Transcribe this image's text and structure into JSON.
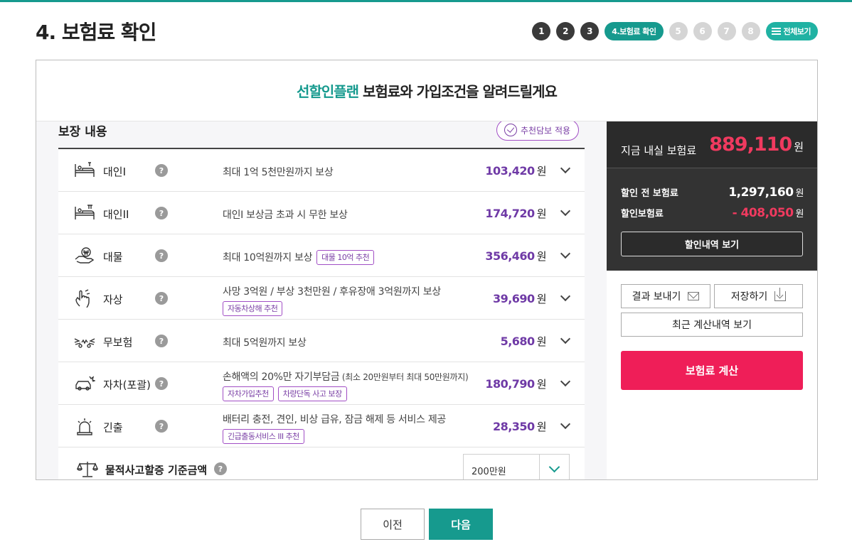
{
  "page": {
    "title": "4. 보험료 확인"
  },
  "steps": {
    "items": [
      {
        "label": "1",
        "state": "done"
      },
      {
        "label": "2",
        "state": "done"
      },
      {
        "label": "3",
        "state": "done"
      },
      {
        "label": "4.보험료 확인",
        "state": "current"
      },
      {
        "label": "5",
        "state": "todo"
      },
      {
        "label": "6",
        "state": "todo"
      },
      {
        "label": "7",
        "state": "todo"
      },
      {
        "label": "8",
        "state": "todo"
      }
    ],
    "all_view_label": "전체보기"
  },
  "header": {
    "accent": "선할인플랜",
    "rest": " 보험료와 가입조건을 알려드릴게요"
  },
  "coverage": {
    "title": "보장 내용",
    "recommend_btn": "추천담보 적용",
    "help_glyph": "?",
    "rows": [
      {
        "icon": "bed-person-icon",
        "name": "대인I",
        "desc": "최대 1억 5천만원까지 보상",
        "amount": "103,420",
        "unit": "원"
      },
      {
        "icon": "bed-person-icon",
        "name": "대인II",
        "desc": "대인I 보상금 초과 시 무한 보상",
        "amount": "174,720",
        "unit": "원"
      },
      {
        "icon": "coin-hand-icon",
        "name": "대물",
        "desc": "최대 10억원까지 보상",
        "inline_tag": "대물 10억 추천",
        "amount": "356,460",
        "unit": "원"
      },
      {
        "icon": "hand-injury-icon",
        "name": "자상",
        "desc": "사망 3억원 / 부상 3천만원 / 후유장애 3억원까지 보상",
        "tags": [
          "자동차상해 추천"
        ],
        "amount": "39,690",
        "unit": "원"
      },
      {
        "icon": "crash-icon",
        "name": "무보험",
        "desc": "최대 5억원까지 보상",
        "amount": "5,680",
        "unit": "원"
      },
      {
        "icon": "car-crash-icon",
        "name": "자차(포괄)",
        "desc": "손해액의 20%만 자기부담금",
        "desc_small": " (최소 20만원부터 최대 50만원까지)",
        "tags": [
          "자차가입추천",
          "차량단독 사고 보장"
        ],
        "amount": "180,790",
        "unit": "원"
      },
      {
        "icon": "siren-icon",
        "name": "긴출",
        "desc": "배터리 충전, 견인, 비상 급유, 잠금 해제 등 서비스 제공",
        "tags": [
          "긴급출동서비스 III 추천"
        ],
        "amount": "28,350",
        "unit": "원"
      }
    ],
    "deductible": {
      "icon": "scale-icon",
      "label": "물적사고할증 기준금액",
      "value": "200만원"
    }
  },
  "summary": {
    "pay_now_label": "지금 내실 보험료",
    "pay_now_value": "889,110",
    "unit": "원",
    "before_label": "할인 전 보험료",
    "before_value": "1,297,160",
    "discount_label": "할인보험료",
    "discount_value": "- 408,050",
    "discount_detail_btn": "할인내역 보기",
    "send_btn": "결과 보내기",
    "save_btn": "저장하기",
    "recent_btn": "최근 계산내역 보기",
    "calc_btn": "보험료 계산"
  },
  "nav": {
    "prev": "이전",
    "next": "다음"
  },
  "colors": {
    "teal": "#169a8e",
    "purple": "#6f3aa6",
    "pink": "#ef1e58",
    "dark": "#2b2b2b"
  }
}
